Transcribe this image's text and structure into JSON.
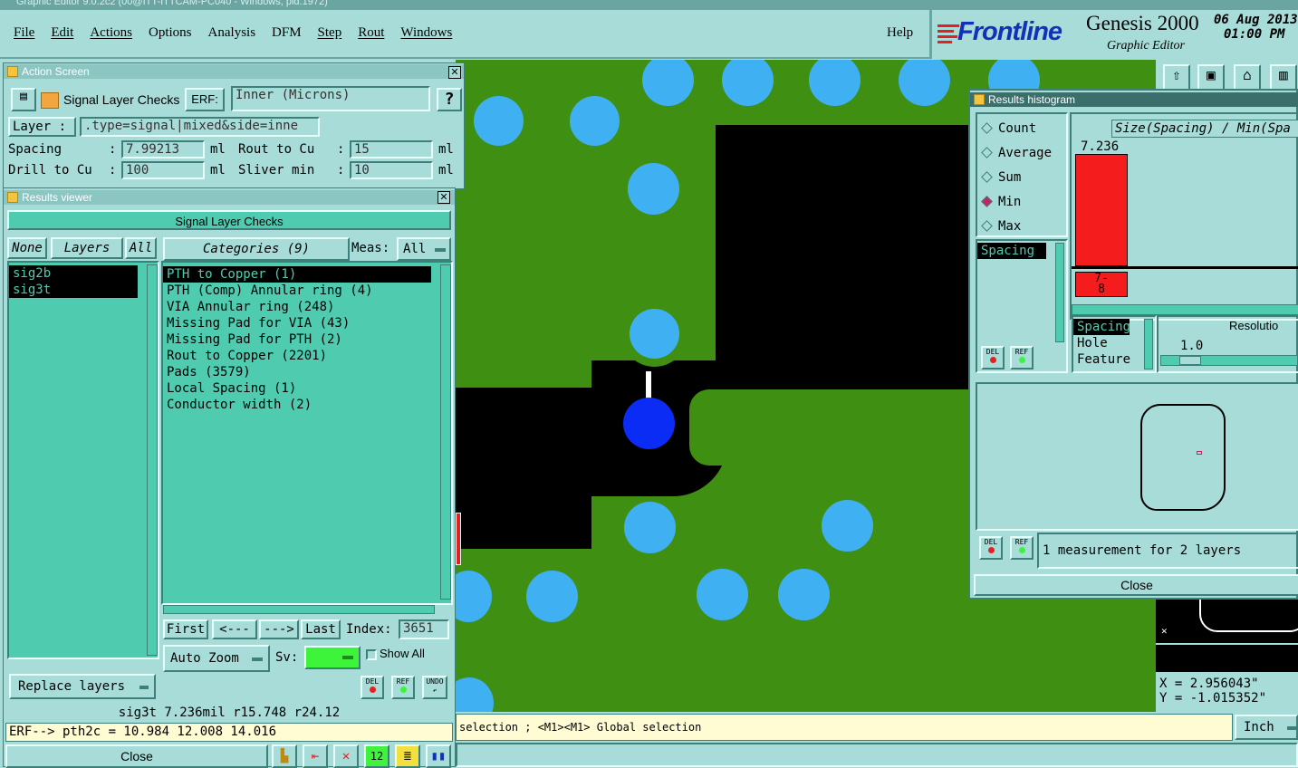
{
  "titlebar": {
    "text": "Graphic Editor 9.0.2c2 (00@ITT-ITTCAM-PC040 - Windows, pid.1972)"
  },
  "menu": {
    "items": [
      "File",
      "Edit",
      "Actions",
      "Options",
      "Analysis",
      "DFM",
      "Step",
      "Rout",
      "Windows"
    ],
    "help": "Help"
  },
  "brand": {
    "logo": "Frontline",
    "product": "Genesis 2000",
    "subtitle": "Graphic Editor",
    "date": "06 Aug 2013",
    "time": "01:00 PM"
  },
  "action_screen": {
    "title": "Action Screen",
    "action_name": "Signal Layer Checks",
    "erf_label": "ERF:",
    "erf_value": "Inner (Microns)",
    "help_label": "?",
    "layer_label": "Layer :",
    "layer_value": ".type=signal|mixed&side=inne",
    "spacing_label": "Spacing",
    "spacing_value": "7.99213",
    "spacing_unit": "ml",
    "rout_label": "Rout to Cu",
    "rout_value": "15",
    "rout_unit": "ml",
    "drill_label": "Drill to Cu",
    "drill_value": "100",
    "drill_unit": "ml",
    "sliver_label": "Sliver min",
    "sliver_value": "10",
    "sliver_unit": "ml"
  },
  "results_viewer": {
    "title": "Results viewer",
    "header": "Signal Layer Checks",
    "none_btn": "None",
    "layers_btn": "Layers",
    "all_btn": "All",
    "categories_btn": "Categories (9)",
    "meas_label": "Meas:",
    "meas_value": "All",
    "layers": [
      "sig2b",
      "sig3t"
    ],
    "categories": [
      "PTH to Copper (1)",
      "PTH (Comp) Annular ring (4)",
      "VIA Annular ring (248)",
      "Missing Pad for VIA (43)",
      "Missing Pad for PTH (2)",
      "Rout to Copper (2201)",
      "Pads (3579)",
      "Local Spacing (1)",
      "Conductor width (2)"
    ],
    "first_btn": "First",
    "prev_btn": "<---",
    "next_btn": "--->",
    "last_btn": "Last",
    "index_label": "Index:",
    "index_value": "3651",
    "autozoom": "Auto Zoom",
    "sv_label": "Sv:",
    "show_all": "Show All",
    "replace_layers": "Replace layers",
    "del": "DEL",
    "ref": "REF",
    "undo": "UNDO",
    "status1": "sig3t 7.236mil  r15.748  r24.12",
    "status2": "ERF--> pth2c = 10.984 12.008 14.016",
    "close": "Close"
  },
  "histogram": {
    "title": "Results histogram",
    "modes": [
      "Count",
      "Average",
      "Sum",
      "Min",
      "Max"
    ],
    "selected_mode": "Min",
    "chart_title": "Size(Spacing) / Min(Spa",
    "bar_value": "7.236",
    "bar_label": "7-8",
    "meas_list": [
      "Spacing"
    ],
    "type_list": [
      "Spacing",
      "Hole",
      "Feature"
    ],
    "resolution_label": "Resolutio",
    "resolution_value": "1.0",
    "del": "DEL",
    "ref": "REF",
    "summary": "1 measurement for 2 layers",
    "close": "Close"
  },
  "coords": {
    "x": "X = 2.956043\"",
    "y": "Y = -1.015352\""
  },
  "status_line": "selection ; <M1><M1> Global selection",
  "units": "Inch",
  "colors": {
    "board": "#3f8f12",
    "pad": "#3fb1f2",
    "selected_pad": "#0a2cf5",
    "histogram_bar": "#f41c1c",
    "panel": "#a7dcd9",
    "list": "#4fccb0"
  }
}
